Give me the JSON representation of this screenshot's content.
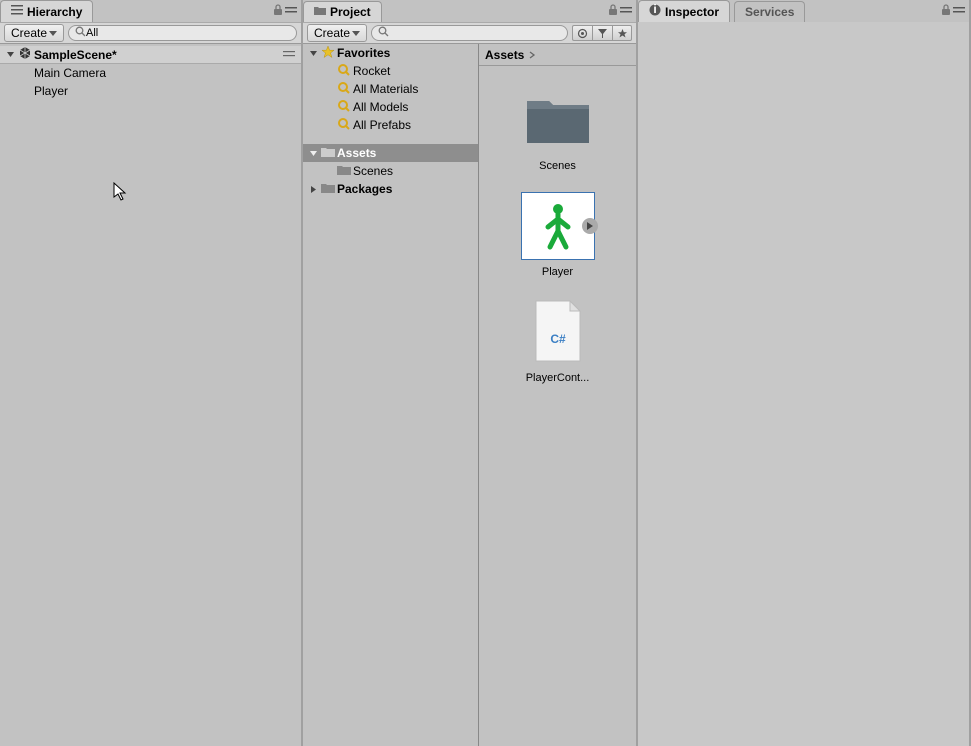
{
  "hierarchy": {
    "tab_label": "Hierarchy",
    "create_label": "Create",
    "search_prefix": "All",
    "scene_name": "SampleScene*",
    "objects": [
      "Main Camera",
      "Player"
    ]
  },
  "project": {
    "tab_label": "Project",
    "create_label": "Create",
    "favorites_label": "Favorites",
    "favorites": [
      "Rocket",
      "All Materials",
      "All Models",
      "All Prefabs"
    ],
    "assets_label": "Assets",
    "assets_children": [
      "Scenes"
    ],
    "packages_label": "Packages",
    "breadcrumb": "Assets",
    "items": [
      {
        "label": "Scenes",
        "type": "folder"
      },
      {
        "label": "Player",
        "type": "prefab",
        "selected": true
      },
      {
        "label": "PlayerCont...",
        "type": "script"
      }
    ]
  },
  "inspector": {
    "tab_label": "Inspector",
    "services_label": "Services"
  }
}
